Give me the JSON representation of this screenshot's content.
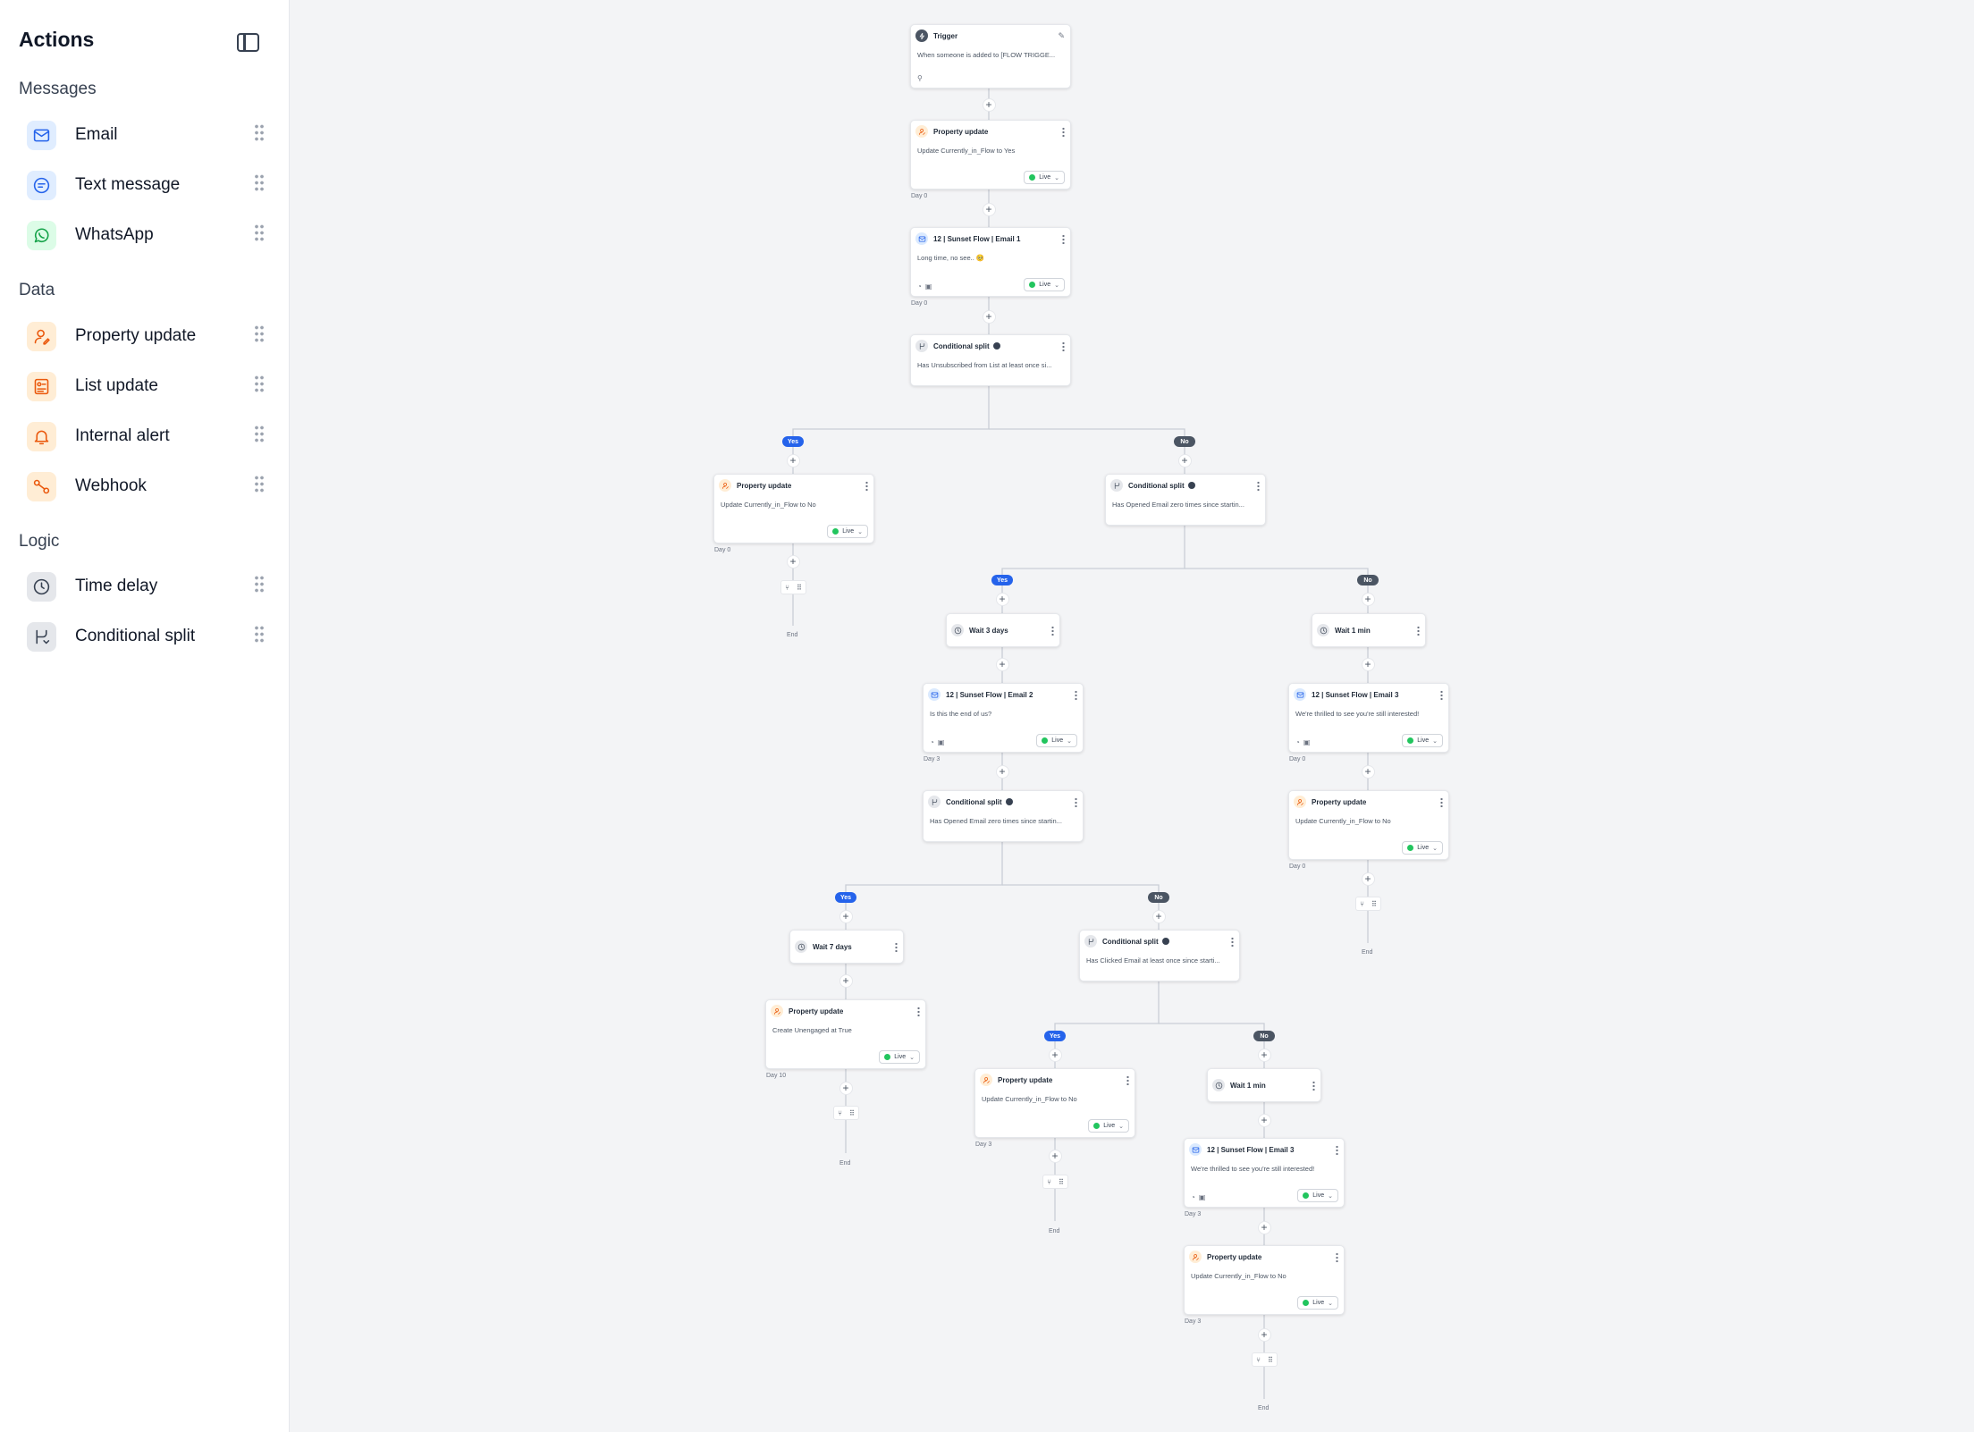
{
  "sidebar": {
    "title": "Actions",
    "sections": {
      "messages": "Messages",
      "data": "Data",
      "logic": "Logic"
    },
    "items": {
      "email": "Email",
      "text_message": "Text message",
      "whatsapp": "WhatsApp",
      "property_update": "Property update",
      "list_update": "List update",
      "internal_alert": "Internal alert",
      "webhook": "Webhook",
      "time_delay": "Time delay",
      "conditional_split": "Conditional split"
    }
  },
  "branch": {
    "yes": "Yes",
    "no": "No"
  },
  "status": "Live",
  "end": "End",
  "nodes": {
    "trigger": {
      "title": "Trigger",
      "body": "When someone is added to [FLOW TRIGGE..."
    },
    "pu1": {
      "title": "Property update",
      "body": "Update Currently_in_Flow to Yes",
      "day": "Day 0"
    },
    "email1": {
      "title": "12 | Sunset Flow | Email 1",
      "body": "Long time, no see.. 🥺",
      "day": "Day 0"
    },
    "cs1": {
      "title": "Conditional split",
      "body": "Has Unsubscribed from List at least once si..."
    },
    "pu2": {
      "title": "Property update",
      "body": "Update Currently_in_Flow to No",
      "day": "Day 0"
    },
    "cs2": {
      "title": "Conditional split",
      "body": "Has Opened Email zero times since startin..."
    },
    "wait1": {
      "title": "Wait 3 days"
    },
    "wait2": {
      "title": "Wait 1 min"
    },
    "email2": {
      "title": "12 | Sunset Flow | Email 2",
      "body": "Is this the end of us?",
      "day": "Day 3"
    },
    "email3a": {
      "title": "12 | Sunset Flow | Email 3",
      "body": "We're thrilled to see you're still interested!",
      "day": "Day 0"
    },
    "cs3": {
      "title": "Conditional split",
      "body": "Has Opened Email zero times since startin..."
    },
    "pu3": {
      "title": "Property update",
      "body": "Update Currently_in_Flow to No",
      "day": "Day 0"
    },
    "wait3": {
      "title": "Wait 7 days"
    },
    "cs4": {
      "title": "Conditional split",
      "body": "Has Clicked Email at least once since starti..."
    },
    "pu4": {
      "title": "Property update",
      "body": "Create Unengaged at True",
      "day": "Day 10"
    },
    "pu5": {
      "title": "Property update",
      "body": "Update Currently_in_Flow to No",
      "day": "Day 3"
    },
    "wait4": {
      "title": "Wait 1 min"
    },
    "email3b": {
      "title": "12 | Sunset Flow | Email 3",
      "body": "We're thrilled to see you're still interested!",
      "day": "Day 3"
    },
    "pu6": {
      "title": "Property update",
      "body": "Update Currently_in_Flow to No",
      "day": "Day 3"
    }
  },
  "colors": {
    "accent": "#2563eb",
    "yes": "#2563eb",
    "no": "#4b5563",
    "live": "#22c55e",
    "property_icon": "#ea580c",
    "canvas": "#f3f4f6"
  }
}
